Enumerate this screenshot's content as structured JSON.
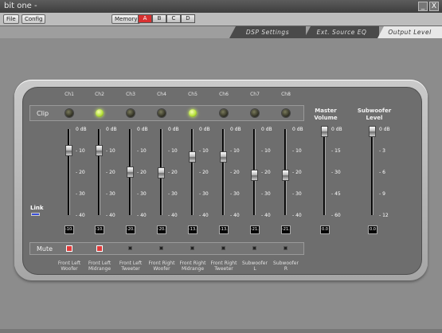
{
  "window": {
    "title": "bit one -",
    "minimize": "_",
    "close": "X"
  },
  "menu": {
    "file": "File",
    "config": "Config",
    "memory": "Memory",
    "presets": [
      "A",
      "B",
      "C",
      "D"
    ]
  },
  "tabs": [
    "DSP Settings",
    "Ext. Source EQ",
    "Output Level"
  ],
  "active_tab": "Output Level",
  "labels": {
    "clip": "Clip",
    "mute": "Mute",
    "link": "Link"
  },
  "channels": [
    {
      "label": "Ch1",
      "clip_on": false,
      "value": "-10.0",
      "level_db": -10.0,
      "mute": true,
      "name": "Front Left\nWoofer"
    },
    {
      "label": "Ch2",
      "clip_on": true,
      "value": "-10.0",
      "level_db": -10.0,
      "mute": true,
      "name": "Front Left\nMidrange"
    },
    {
      "label": "Ch3",
      "clip_on": false,
      "value": "-20.0",
      "level_db": -20.0,
      "mute": false,
      "name": "Front Left\nTweeter"
    },
    {
      "label": "Ch4",
      "clip_on": false,
      "value": "-20.5",
      "level_db": -20.5,
      "mute": false,
      "name": "Front Right\nWoofer"
    },
    {
      "label": "Ch5",
      "clip_on": true,
      "value": "-13.0",
      "level_db": -13.0,
      "mute": false,
      "name": "Front Right\nMidrange"
    },
    {
      "label": "Ch6",
      "clip_on": false,
      "value": "-13.0",
      "level_db": -13.0,
      "mute": false,
      "name": "Front Right\nTweeter"
    },
    {
      "label": "Ch7",
      "clip_on": false,
      "value": "-21.5",
      "level_db": -21.5,
      "mute": false,
      "name": "Subwoofer\nL"
    },
    {
      "label": "Ch8",
      "clip_on": false,
      "value": "-21.5",
      "level_db": -21.5,
      "mute": false,
      "name": "Subwoofer\nR"
    }
  ],
  "channel_scale": [
    "0 dB",
    "- 10",
    "- 20",
    "- 30",
    "- 40"
  ],
  "master": {
    "label": "Master\nVolume",
    "value": "0.0",
    "level_db": 0,
    "scale": [
      "0 dB",
      "- 15",
      "- 30",
      "- 45",
      "- 60"
    ]
  },
  "subwoofer": {
    "label": "Subwoofer\nLevel",
    "value": "0.0",
    "level_db": 0,
    "scale": [
      "0 dB",
      "- 3",
      "- 6",
      "- 9",
      "- 12"
    ]
  },
  "colors": {
    "clip_led_on": "#b6e13c",
    "mute_on": "#e03a3a",
    "link": "#3a4fd8",
    "active_preset": "#d83030"
  }
}
